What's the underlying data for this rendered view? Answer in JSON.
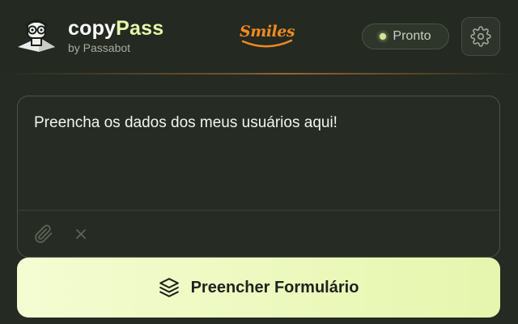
{
  "header": {
    "logo_icon": "pilot-bot-icon",
    "brand_name_part1": "copy",
    "brand_name_part2": "Pass",
    "brand_subtitle": "by Passabot",
    "partner_logo_text": "Smiles",
    "status_label": "Pronto",
    "settings_icon": "gear-icon"
  },
  "input_card": {
    "text": "Preencha os dados dos meus usuários aqui!",
    "attach_icon": "paperclip-icon",
    "clear_icon": "close-icon"
  },
  "action": {
    "label": "Preencher Formulário",
    "icon": "layers-icon"
  },
  "colors": {
    "background": "#252a22",
    "accent": "#e4f7a8",
    "partner_orange": "#f08a1e",
    "status_dot": "#cfe89a"
  }
}
